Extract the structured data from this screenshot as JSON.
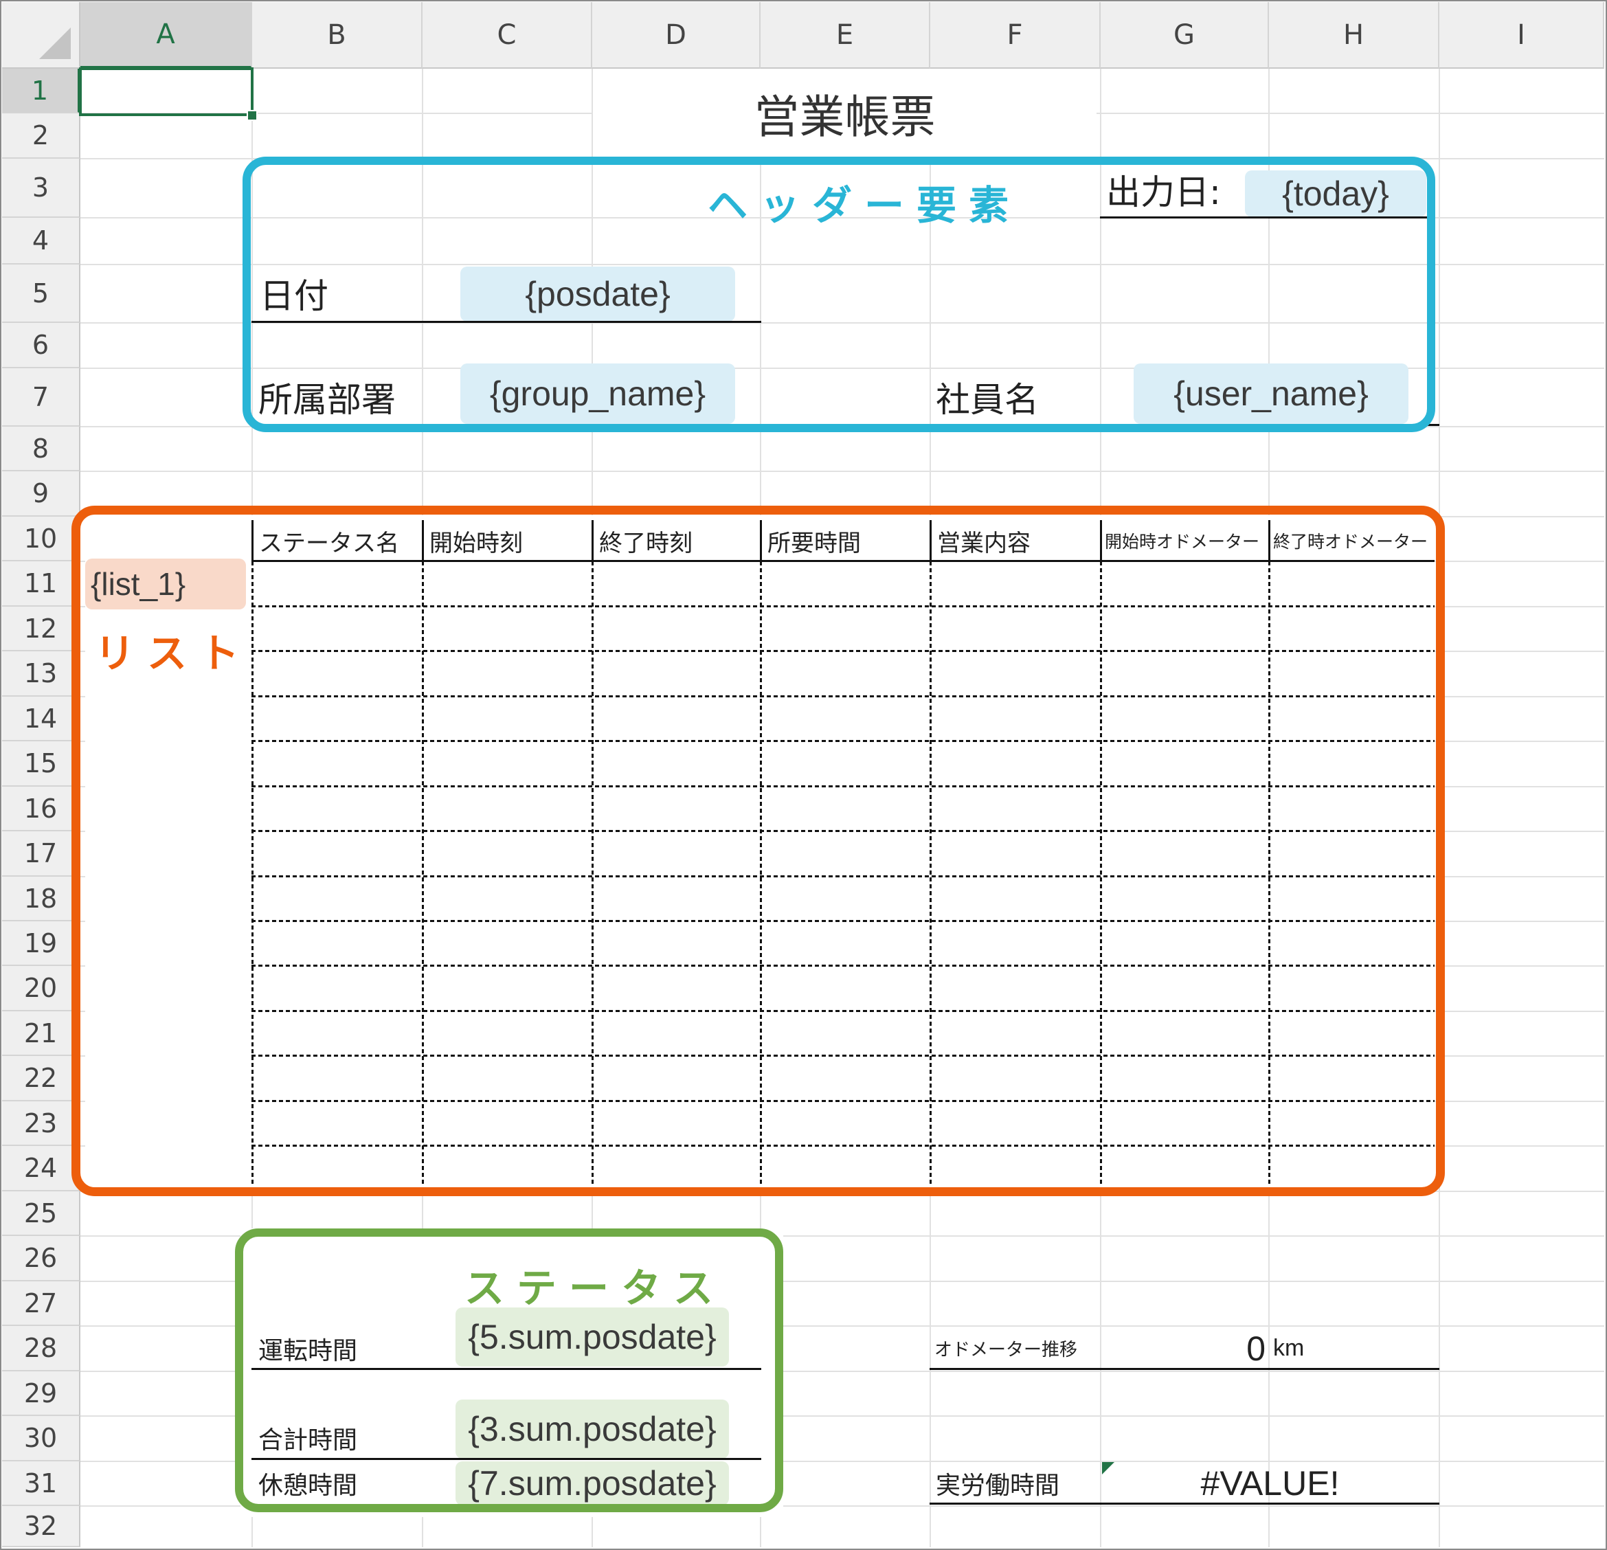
{
  "columns": [
    "A",
    "B",
    "C",
    "D",
    "E",
    "F",
    "G",
    "H",
    "I"
  ],
  "rows": [
    "1",
    "2",
    "3",
    "4",
    "5",
    "6",
    "7",
    "8",
    "9",
    "10",
    "11",
    "12",
    "13",
    "14",
    "15",
    "16",
    "17",
    "18",
    "19",
    "20",
    "21",
    "22",
    "23",
    "24",
    "25",
    "26",
    "27",
    "28",
    "29",
    "30",
    "31",
    "32"
  ],
  "selected_cell": "A1",
  "title": "営業帳票",
  "header": {
    "annotation": "ヘッダー要素",
    "output_date_label": "出力日:",
    "today_placeholder": "{today}",
    "date_label": "日付",
    "posdate_placeholder": "{posdate}",
    "department_label": "所属部署",
    "group_name_placeholder": "{group_name}",
    "employee_label": "社員名",
    "user_name_placeholder": "{user_name}"
  },
  "list": {
    "annotation": "リスト",
    "placeholder": "{list_1}",
    "columns": [
      "ステータス名",
      "開始時刻",
      "終了時刻",
      "所要時間",
      "営業内容",
      "開始時オドメーター",
      "終了時オドメーター"
    ]
  },
  "status": {
    "annotation": "ステータス",
    "driving_time_label": "運転時間",
    "driving_time_placeholder": "{5.sum.posdate}",
    "total_time_label": "合計時間",
    "total_time_placeholder": "{3.sum.posdate}",
    "break_time_label": "休憩時間",
    "break_time_placeholder": "{7.sum.posdate}"
  },
  "summary": {
    "odometer_label": "オドメーター推移",
    "odometer_value": "0",
    "odometer_unit": "km",
    "actual_work_label": "実労働時間",
    "actual_work_value": "#VALUE!"
  },
  "colors": {
    "header_box": "#29b5d6",
    "list_box": "#ed5e0c",
    "status_box": "#6faa46",
    "selection": "#217346"
  }
}
